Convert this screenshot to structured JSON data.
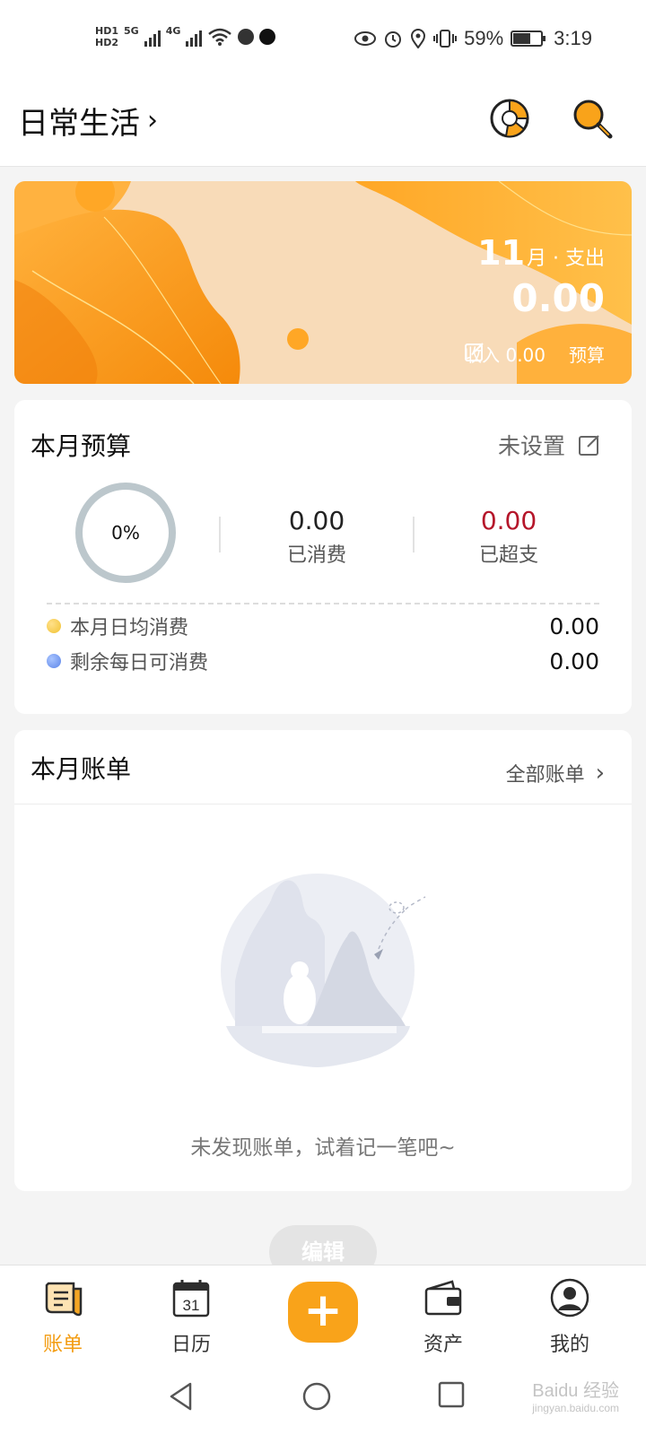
{
  "status_bar": {
    "hd1": "HD1",
    "hd2": "HD2",
    "net1": "5G",
    "net2": "4G",
    "battery": "59%",
    "time": "3:19"
  },
  "header": {
    "title": "日常生活",
    "chart_icon": "pie-chart-icon",
    "search_icon": "search-icon"
  },
  "banner": {
    "month": "11",
    "month_suffix": "月 · 支出",
    "amount": "0.00",
    "income_label": "收入 0.00",
    "budget_label": "预算"
  },
  "budget": {
    "title": "本月预算",
    "status": "未设置",
    "percent": "0%",
    "spent_value": "0.00",
    "spent_label": "已消费",
    "over_value": "0.00",
    "over_label": "已超支",
    "daily_avg_label": "本月日均消费",
    "daily_avg_value": "0.00",
    "remaining_label": "剩余每日可消费",
    "remaining_value": "0.00"
  },
  "bills": {
    "title": "本月账单",
    "all_link": "全部账单",
    "empty_text": "未发现账单，试着记一笔吧~"
  },
  "edit_button": "编辑",
  "tabs": [
    {
      "label": "账单",
      "icon": "bill-icon",
      "active": true
    },
    {
      "label": "日历",
      "icon": "calendar-icon",
      "active": false,
      "day": "31"
    },
    {
      "label": "资产",
      "icon": "wallet-icon",
      "active": false
    },
    {
      "label": "我的",
      "icon": "profile-icon",
      "active": false
    }
  ],
  "add_button_icon": "plus-icon",
  "watermark": {
    "main": "Baidu 经验",
    "sub": "jingyan.baidu.com"
  },
  "colors": {
    "accent": "#f9a31a",
    "over_budget": "#b5162a",
    "ring": "#bcc7cc"
  }
}
